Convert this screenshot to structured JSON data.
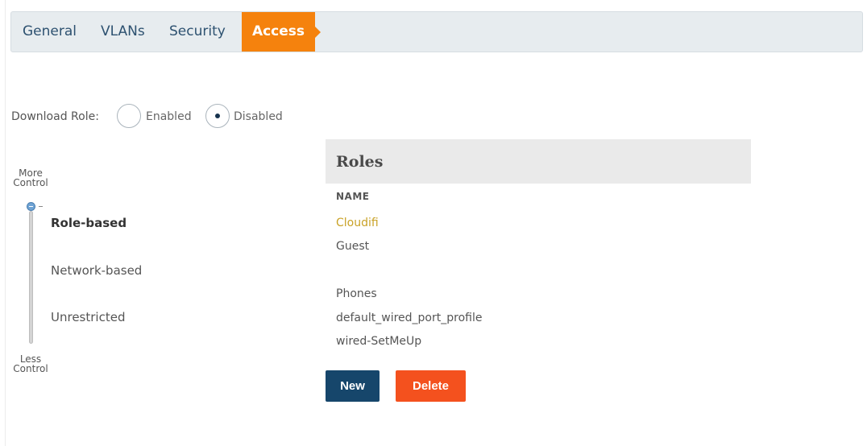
{
  "tabs": [
    {
      "label": "General",
      "active": false
    },
    {
      "label": "VLANs",
      "active": false
    },
    {
      "label": "Security",
      "active": false
    },
    {
      "label": "Access",
      "active": true
    }
  ],
  "download_role": {
    "label": "Download Role:",
    "options": [
      {
        "label": "Enabled",
        "selected": false
      },
      {
        "label": "Disabled",
        "selected": true
      }
    ]
  },
  "access_control": {
    "more_line1": "More",
    "more_line2": "Control",
    "less_line1": "Less",
    "less_line2": "Control",
    "levels": [
      {
        "label": "Role-based",
        "selected": true
      },
      {
        "label": "Network-based",
        "selected": false
      },
      {
        "label": "Unrestricted",
        "selected": false
      }
    ]
  },
  "roles": {
    "title": "Roles",
    "column": "NAME",
    "items": [
      {
        "name": "Cloudifi",
        "highlight": true
      },
      {
        "name": "Guest",
        "highlight": false
      },
      {
        "name": "Phones",
        "highlight": false
      },
      {
        "name": "default_wired_port_profile",
        "highlight": false
      },
      {
        "name": "wired-SetMeUp",
        "highlight": false
      }
    ]
  },
  "buttons": {
    "new": "New",
    "delete": "Delete"
  },
  "colors": {
    "active_tab": "#f5820d",
    "new_button": "#16466b",
    "delete_button": "#f4511e",
    "highlight_role": "#c9a227"
  }
}
